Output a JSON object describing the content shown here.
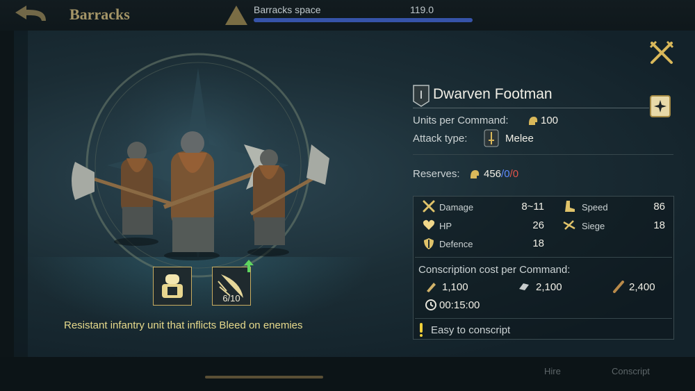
{
  "header": {
    "title": "Barracks",
    "space_label": "Barracks space",
    "space_value": "119.0"
  },
  "unit": {
    "tier": "I",
    "name": "Dwarven Footman",
    "units_per_command_label": "Units per Command:",
    "units_per_command_value": "100",
    "attack_type_label": "Attack type:",
    "attack_type_value": "Melee",
    "reserves_label": "Reserves:",
    "reserves_main": "456",
    "reserves_sep1": "/",
    "reserves_blue": "0",
    "reserves_sep2": "/",
    "reserves_red": "0",
    "tagline": "Resistant infantry unit that inflicts Bleed on enemies",
    "trait_progress": "6/10"
  },
  "stats": {
    "damage_label": "Damage",
    "damage_value": "8~11",
    "speed_label": "Speed",
    "speed_value": "86",
    "hp_label": "HP",
    "hp_value": "26",
    "siege_label": "Siege",
    "siege_value": "18",
    "defence_label": "Defence",
    "defence_value": "18"
  },
  "cost": {
    "heading": "Conscription cost per Command:",
    "food": "1,100",
    "iron": "2,100",
    "wood": "2,400",
    "time": "00:15:00",
    "note": "Easy to conscript"
  },
  "footer": {
    "hire_label": "Hire",
    "conscript_label": "Conscript"
  },
  "icons": {
    "back": "back-arrow-icon",
    "close": "crossed-axes-close-icon",
    "codex": "codex-scroll-icon",
    "helmet": "helmet-icon",
    "melee": "sword-icon"
  },
  "colors": {
    "accent_gold": "#c9ad61",
    "reserve_blue": "#5f8bff",
    "reserve_red": "#e3544b",
    "tagline_yellow": "#e7da8c"
  }
}
